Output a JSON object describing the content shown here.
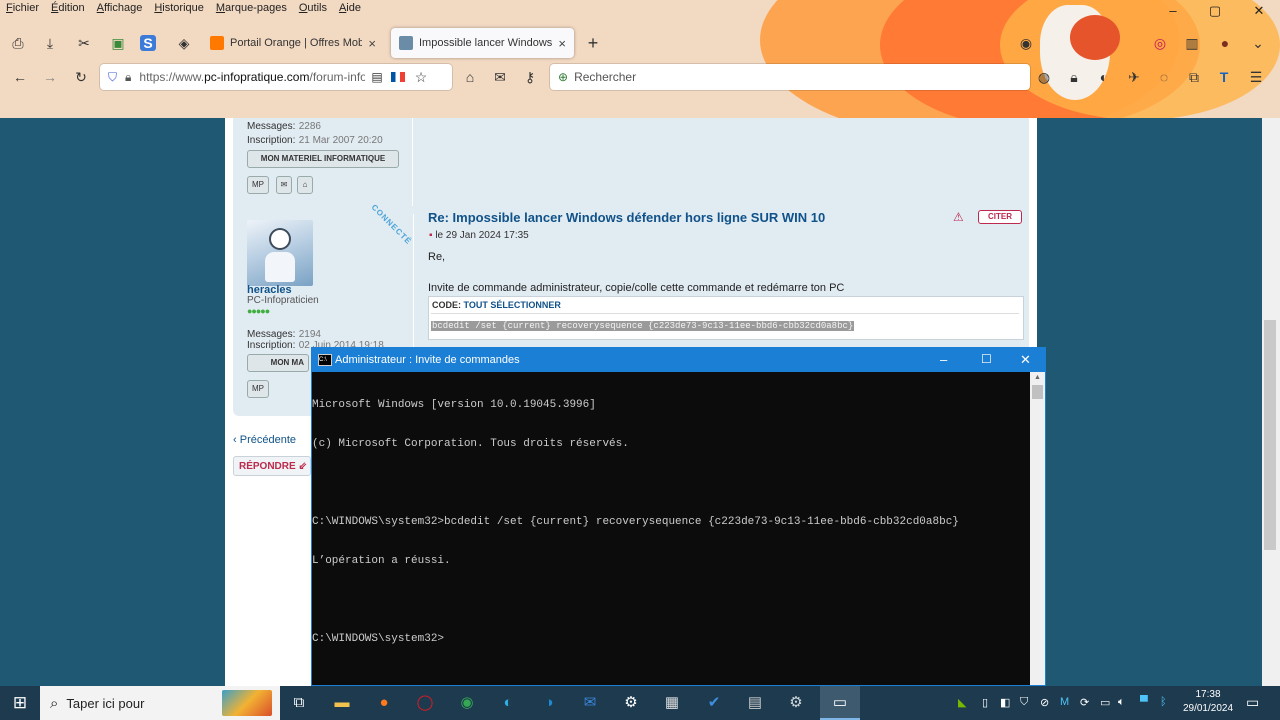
{
  "menu": [
    "Fichier",
    "Édition",
    "Affichage",
    "Historique",
    "Marque-pages",
    "Outils",
    "Aide"
  ],
  "tabs": [
    {
      "title": "Portail Orange | Offres Mobiles",
      "active": false,
      "close": "×"
    },
    {
      "title": "Impossible lancer Windows défe",
      "active": true,
      "close": "×"
    }
  ],
  "new_tab": "+",
  "url": {
    "prefix": "https://www.",
    "domain": "pc-infopratique.com",
    "path": "/forum-info"
  },
  "search": {
    "placeholder": "Rechercher"
  },
  "post1": {
    "messages_label": "Messages:",
    "messages_value": "2286",
    "inscription_label": "Inscription:",
    "inscription_value": "21 Mar 2007 20:20",
    "materiel_button": "MON MATERIEL INFORMATIQUE",
    "mp": "MP"
  },
  "post2": {
    "badge": "CONNECTÉ",
    "username": "heracles",
    "rank": "PC-Infopraticien",
    "messages_label": "Messages:",
    "messages_value": "2194",
    "inscription_label": "Inscription:",
    "inscription_value": "02 Juin 2014 19:18",
    "materiel_button": "MON MA",
    "mp": "MP",
    "title": "Re: Impossible lancer Windows défender hors ligne SUR WIN 10",
    "date": "le 29 Jan 2024 17:35",
    "citer": "CITER",
    "greeting": "Re,",
    "body": "Invite de commande administrateur, copie/colle cette commande et redémarre ton PC",
    "code_label": "CODE:",
    "code_select": "TOUT SÉLECTIONNER",
    "code": "bcdedit /set {current} recoverysequence {c223de73-9c13-11ee-bbd6-cbb32cd0a8bc}"
  },
  "pagination": {
    "prev": "Précédente",
    "reply": "RÉPONDRE"
  },
  "cmd": {
    "title": "Administrateur : Invite de commandes",
    "lines": [
      "Microsoft Windows [version 10.0.19045.3996]",
      "(c) Microsoft Corporation. Tous droits réservés.",
      "",
      "C:\\WINDOWS\\system32>bcdedit /set {current} recoverysequence {c223de73-9c13-11ee-bbd6-cbb32cd0a8bc}",
      "L’opération a réussi.",
      "",
      "C:\\WINDOWS\\system32>"
    ]
  },
  "taskbar": {
    "search_text": "Taper ici pour",
    "time": "17:38",
    "date": "29/01/2024"
  },
  "colors": {
    "accent": "#1c7fd6",
    "link": "#105289",
    "citer": "#bc2a4d",
    "page_bg": "#1f5873",
    "post_bg": "#e1ebf2"
  }
}
